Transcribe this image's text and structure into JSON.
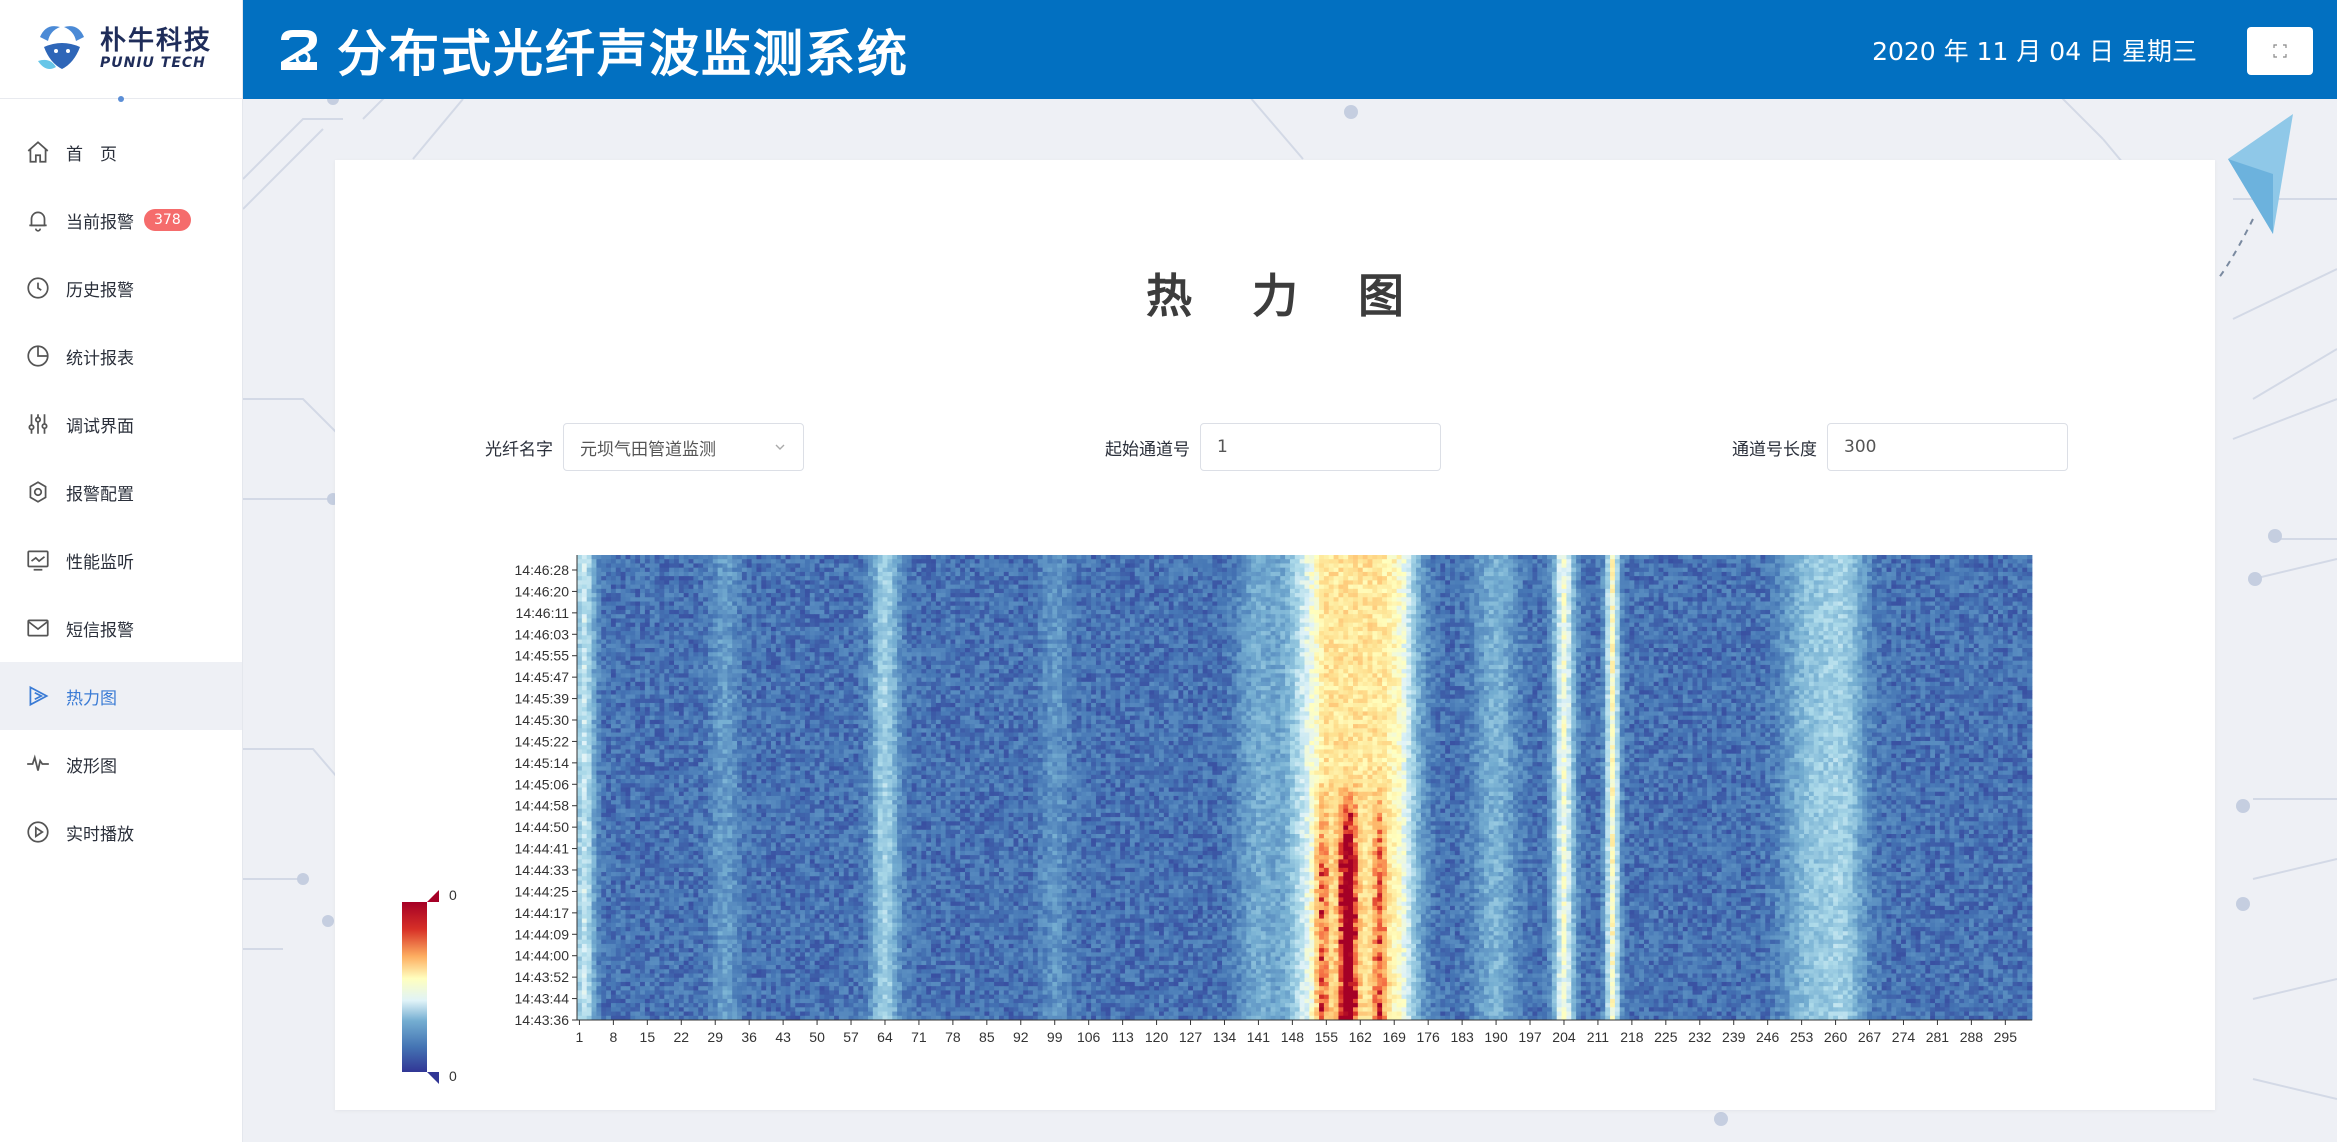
{
  "brand": {
    "logo_cn": "朴牛科技",
    "logo_en": "PUNIU TECH"
  },
  "header": {
    "title": "分布式光纤声波监测系统",
    "date": "2020 年 11 月 04 日 星期三",
    "accent": "#0270c1"
  },
  "sidebar": {
    "items": [
      {
        "label": "首　页",
        "icon": "home-icon"
      },
      {
        "label": "当前报警",
        "icon": "bell-icon",
        "badge": "378"
      },
      {
        "label": "历史报警",
        "icon": "clock-icon"
      },
      {
        "label": "统计报表",
        "icon": "pie-chart-icon"
      },
      {
        "label": "调试界面",
        "icon": "sliders-icon"
      },
      {
        "label": "报警配置",
        "icon": "gear-icon"
      },
      {
        "label": "性能监听",
        "icon": "monitor-icon"
      },
      {
        "label": "短信报警",
        "icon": "mail-icon"
      },
      {
        "label": "热力图",
        "icon": "heatmap-icon",
        "active": true
      },
      {
        "label": "波形图",
        "icon": "waveform-icon"
      },
      {
        "label": "实时播放",
        "icon": "play-icon"
      }
    ]
  },
  "page": {
    "title": "热力图",
    "form": {
      "fiber_label": "光纤名字",
      "fiber_value": "元坝气田管道监测",
      "start_label": "起始通道号",
      "start_value": "1",
      "length_label": "通道号长度",
      "length_value": "300"
    }
  },
  "chart_data": {
    "type": "heatmap",
    "x": [
      1,
      8,
      15,
      22,
      29,
      36,
      43,
      50,
      57,
      64,
      71,
      78,
      85,
      92,
      99,
      106,
      113,
      120,
      127,
      134,
      141,
      148,
      155,
      162,
      169,
      176,
      183,
      190,
      197,
      204,
      211,
      218,
      225,
      232,
      239,
      246,
      253,
      260,
      267,
      274,
      281,
      288,
      295
    ],
    "y": [
      "14:46:28",
      "14:46:20",
      "14:46:11",
      "14:46:03",
      "14:45:55",
      "14:45:47",
      "14:45:39",
      "14:45:30",
      "14:45:22",
      "14:45:14",
      "14:45:06",
      "14:44:58",
      "14:44:50",
      "14:44:41",
      "14:44:33",
      "14:44:25",
      "14:44:17",
      "14:44:09",
      "14:44:00",
      "14:43:52",
      "14:43:44",
      "14:43:36"
    ],
    "visual_map": {
      "min_label": "0",
      "max_label": "0"
    },
    "colors": [
      "#313695",
      "#4575b4",
      "#74add1",
      "#abd9e9",
      "#e0f3f8",
      "#ffffbf",
      "#fee090",
      "#fdae61",
      "#f46d43",
      "#d73027",
      "#a50026"
    ]
  }
}
